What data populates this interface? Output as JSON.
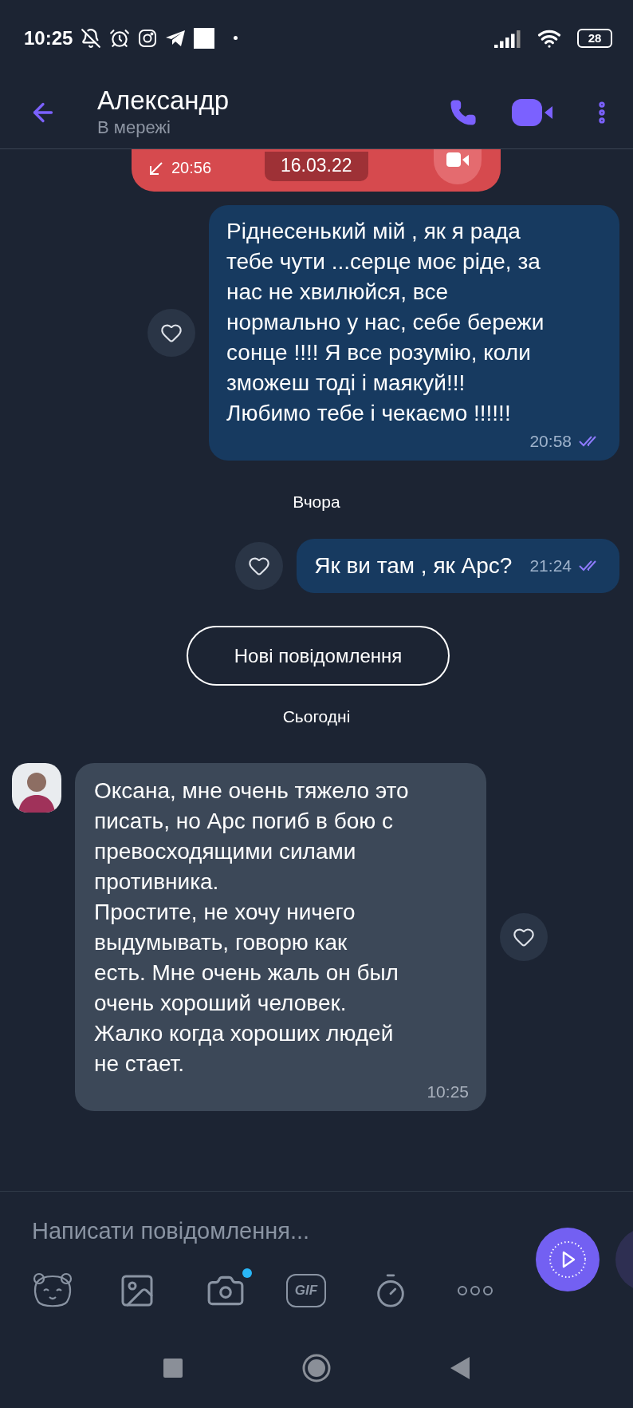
{
  "status_bar": {
    "time": "10:25",
    "battery": "28"
  },
  "header": {
    "title": "Александр",
    "subtitle": "В мережі"
  },
  "chat": [
    {
      "kind": "call",
      "time": "20:56",
      "date": "16.03.22"
    },
    {
      "kind": "outgoing",
      "lines": [
        "Ріднесенький мій , як я рада",
        "тебе чути ...серце моє ріде, за",
        "нас не хвилюйся, все",
        "нормально у нас, себе бережи",
        "сонце !!!! Я все розумію, коли",
        "зможеш тоді і маякуй!!!",
        "Любимо тебе і чекаємо !!!!!!"
      ],
      "time": "20:58",
      "read": true
    },
    {
      "kind": "date",
      "text": "Вчора"
    },
    {
      "kind": "outgoing",
      "lines": [
        "Як ви там , як Арс?"
      ],
      "time": "21:24",
      "read": true
    },
    {
      "kind": "button",
      "label": "Нові повідомлення"
    },
    {
      "kind": "date",
      "text": "Сьогодні"
    },
    {
      "kind": "incoming",
      "lines": [
        "Оксана, мне очень тяжело это",
        "писать, но Арс погиб в бою с",
        "превосходящими силами",
        "противника.",
        "Простите, не хочу ничего",
        "выдумывать, говорю как",
        "есть. Мне очень жаль он был",
        "очень хороший человек.",
        "Жалко когда хороших людей",
        "не стает."
      ],
      "time": "10:25"
    }
  ],
  "composer": {
    "placeholder": "Написати повідомлення...",
    "gif_label": "GIF",
    "camera_badge": true
  }
}
